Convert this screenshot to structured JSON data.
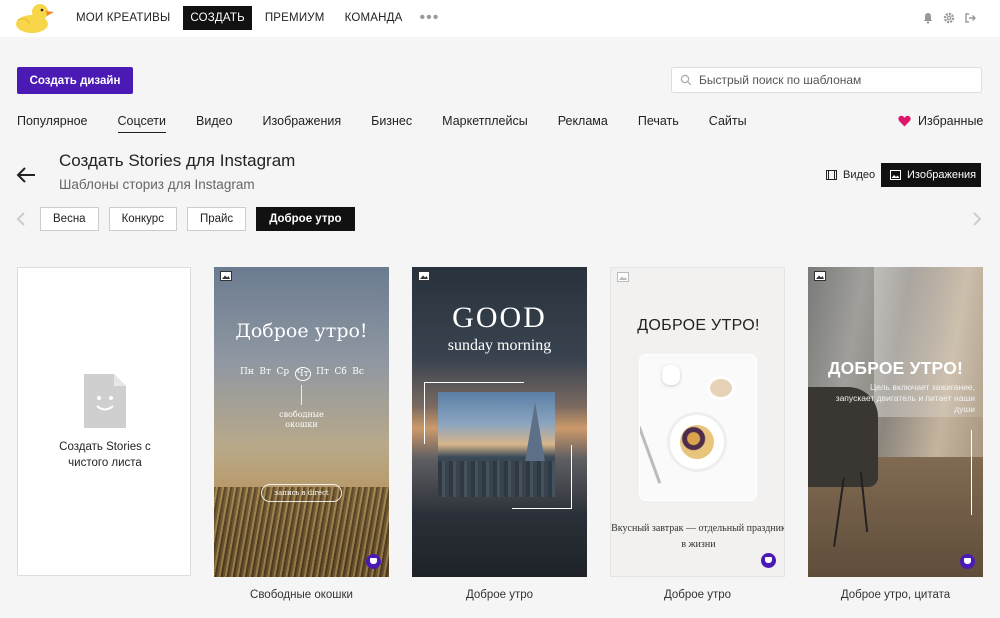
{
  "topbar": {
    "nav": [
      "МОИ КРЕАТИВЫ",
      "СОЗДАТЬ",
      "ПРЕМИУМ",
      "КОМАНДА"
    ],
    "active_nav": "СОЗДАТЬ",
    "more": "•••",
    "icons": [
      "bell-icon",
      "gear-icon",
      "logout-icon"
    ]
  },
  "create_button": "Создать дизайн",
  "search": {
    "placeholder": "Быстрый поиск по шаблонам",
    "value": ""
  },
  "categories": [
    "Популярное",
    "Соцсети",
    "Видео",
    "Изображения",
    "Бизнес",
    "Маркетплейсы",
    "Реклама",
    "Печать",
    "Сайты"
  ],
  "active_category": "Соцсети",
  "favorites": {
    "label": "Избранные",
    "icon_color": "#e0166a"
  },
  "page": {
    "title": "Создать Stories для Instagram",
    "subtitle": "Шаблоны сториз для Instagram"
  },
  "format_toggle": {
    "video": "Видео",
    "images": "Изображения",
    "selected": "Изображения"
  },
  "filters": [
    "Весна",
    "Конкурс",
    "Прайс",
    "Доброе утро"
  ],
  "active_filter": "Доброе утро",
  "blank_card": {
    "label": "Создать Stories с чистого листа"
  },
  "templates": [
    {
      "caption": "Свободные окошки",
      "title": "Доброе утро!",
      "days": [
        "Пн",
        "Вт",
        "Ср",
        "Чт",
        "Пт",
        "Сб",
        "Вс"
      ],
      "sub": "свободные\nокошки",
      "cta": "запись в direct"
    },
    {
      "caption": "Доброе утро",
      "title": "GOOD",
      "sub": "sunday morning"
    },
    {
      "caption": "Доброе утро",
      "title": "ДОБРОЕ УТРО!",
      "sub": "Вкусный завтрак — отдельный праздник в жизни"
    },
    {
      "caption": "Доброе утро, цитата",
      "title": "ДОБРОЕ УТРО!",
      "sub": "Цель включает зажигание, запускает двигатель и питает наши души"
    }
  ],
  "colors": {
    "accent": "#4b1ab4",
    "active_bg": "#111111"
  }
}
